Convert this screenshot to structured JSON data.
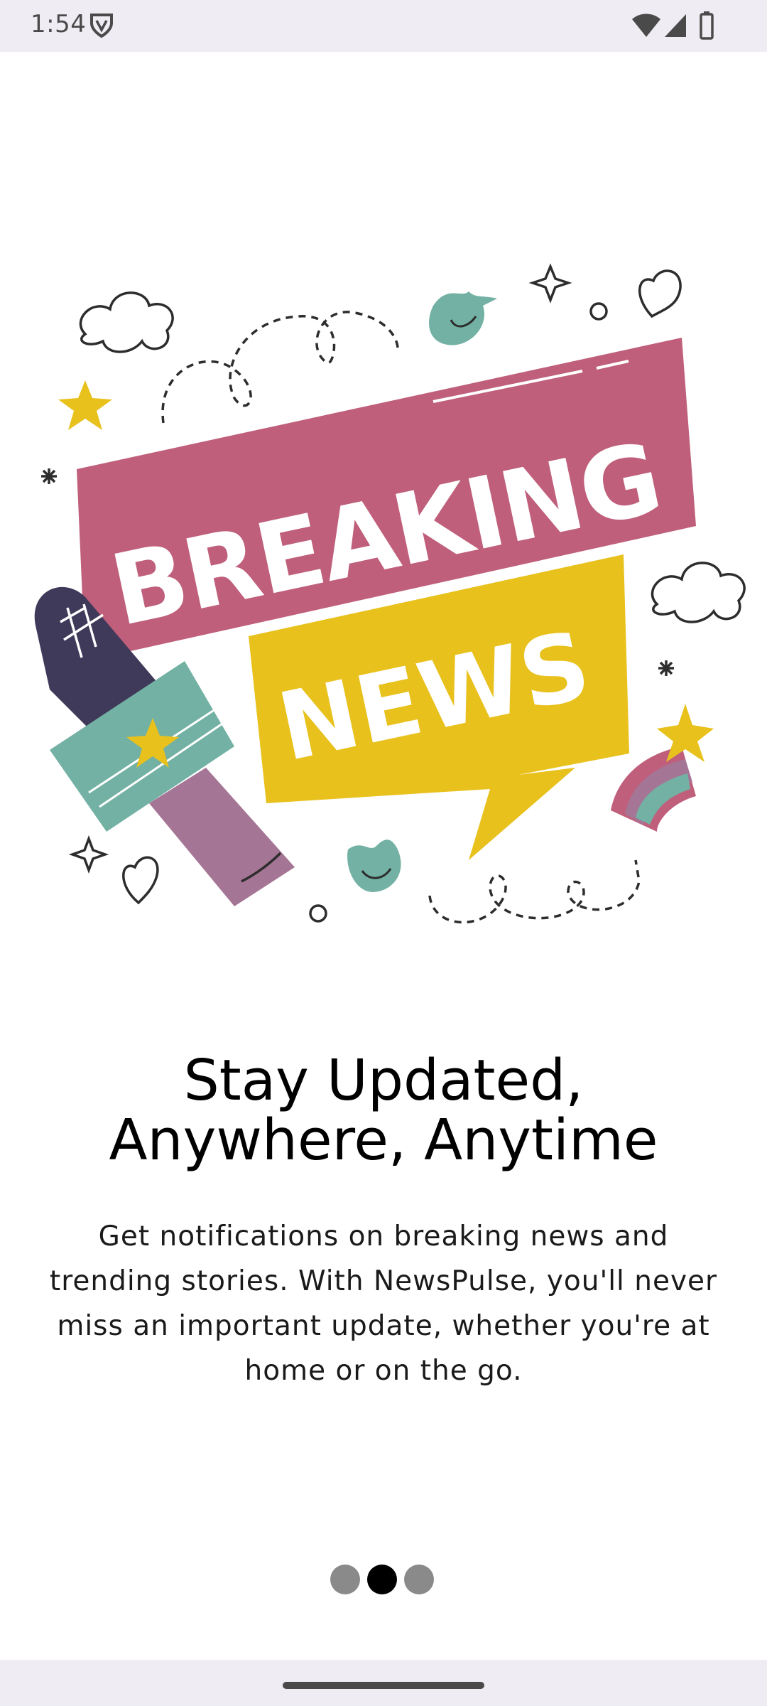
{
  "status_bar": {
    "time": "1:54",
    "icons": [
      "vpn-shield-icon",
      "wifi-icon",
      "cell-signal-icon",
      "battery-icon"
    ]
  },
  "illustration": {
    "banner_top": "BREAKING",
    "banner_bottom": "NEWS",
    "colors": {
      "pink": "#bf5f7b",
      "yellow": "#e8c11d",
      "teal": "#72b1a3",
      "purple": "#a57595",
      "dark": "#3f3a5a"
    }
  },
  "onboarding": {
    "title_line1": "Stay Updated,",
    "title_line2": "Anywhere, Anytime",
    "body_line1": "Get notifications on breaking news and",
    "body_line2": "trending stories. With NewsPulse, you'll never",
    "body_line3": "miss an important update, whether you're at",
    "body_line4": "home or on the go."
  },
  "pager": {
    "total": 3,
    "active_index": 1
  }
}
